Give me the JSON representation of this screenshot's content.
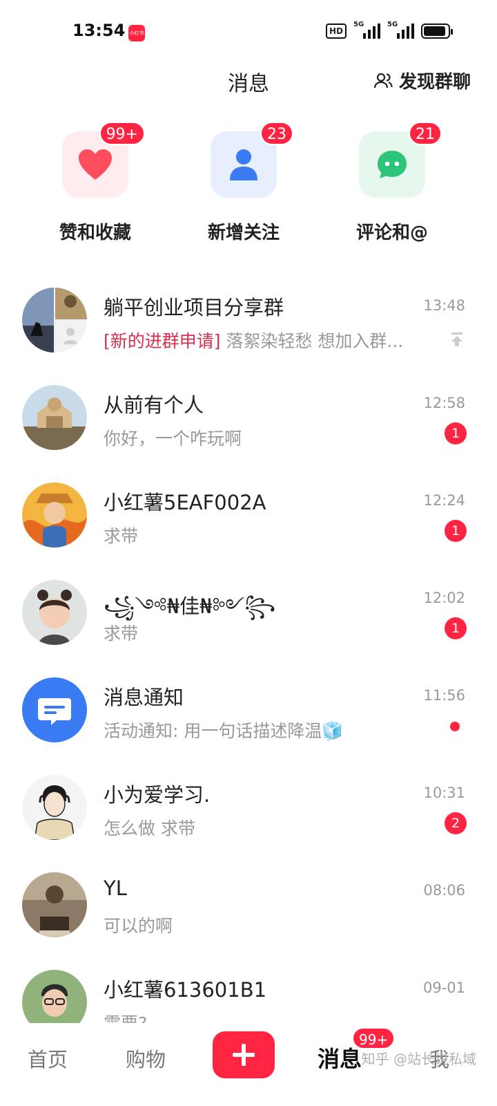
{
  "status_bar": {
    "time": "13:54",
    "app_icon_text": "小红书",
    "hd": "HD",
    "signal1": "5G",
    "signal2": "5G",
    "battery_level": 0.9
  },
  "header": {
    "title": "消息",
    "discover_label": "发现群聊",
    "discover_icon": "users-icon"
  },
  "tiles": [
    {
      "label": "赞和收藏",
      "badge": "99+",
      "icon": "heart-icon",
      "color": "#ff4d5e"
    },
    {
      "label": "新增关注",
      "badge": "23",
      "icon": "person-icon",
      "color": "#3a7af2"
    },
    {
      "label": "评论和@",
      "badge": "21",
      "icon": "chat-bubble-icon",
      "color": "#2ec57a"
    }
  ],
  "conversations": [
    {
      "name": "躺平创业项目分享群",
      "tag": "[新的进群申请]",
      "preview": " 落絮染轻愁 想加入群...",
      "time": "13:48",
      "pinned": true
    },
    {
      "name": "从前有个人",
      "preview": "你好，一个咋玩啊",
      "time": "12:58",
      "unread": "1"
    },
    {
      "name": "小红薯5EAF002A",
      "preview": "求带",
      "time": "12:24",
      "unread": "1"
    },
    {
      "name": "꧁༺₦佳₦༻꧂",
      "preview": "求带",
      "time": "12:02",
      "unread": "1"
    },
    {
      "name": "消息通知",
      "preview": "活动通知: 用一句话描述降温🧊",
      "time": "11:56",
      "dot": true
    },
    {
      "name": "小为爱学习.",
      "preview": "怎么做 求带",
      "time": "10:31",
      "unread": "2"
    },
    {
      "name": "YL",
      "preview": "可以的啊",
      "time": "08:06"
    },
    {
      "name": "小红薯613601B1",
      "preview": "需要?",
      "time": "09-01"
    }
  ],
  "bottom_nav": {
    "home": "首页",
    "shop": "购物",
    "messages": "消息",
    "me": "我",
    "messages_badge": "99+",
    "watermark": "知乎 @站长说私域"
  },
  "colors": {
    "accent": "#ff2442",
    "notify_blue": "#3a7af2"
  }
}
